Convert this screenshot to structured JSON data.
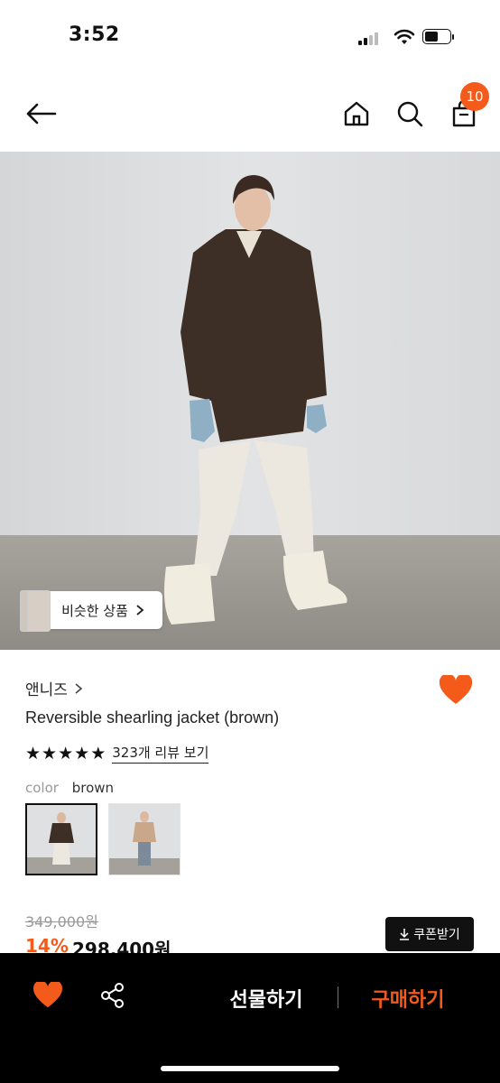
{
  "status_bar": {
    "time": "3:52"
  },
  "header": {
    "cart_count": "10"
  },
  "hero": {
    "similar_label": "비슷한 상품"
  },
  "product": {
    "brand": "앤니즈",
    "title": "Reversible shearling jacket (brown)",
    "rating": 5,
    "review_link": "323개 리뷰 보기",
    "color_label": "color",
    "color_value": "brown",
    "original_price": "349,000원",
    "discount": "14%",
    "sale_price": "298,400원",
    "coupon_label": "쿠폰받기"
  },
  "bottom_bar": {
    "gift_label": "선물하기",
    "buy_label": "구매하기"
  },
  "colors": {
    "accent": "#f45a19",
    "black": "#111111"
  },
  "icons": [
    "back-arrow-icon",
    "home-icon",
    "search-icon",
    "bag-icon",
    "chevron-right-icon",
    "star-icon",
    "download-icon",
    "heart-icon",
    "share-icon"
  ]
}
